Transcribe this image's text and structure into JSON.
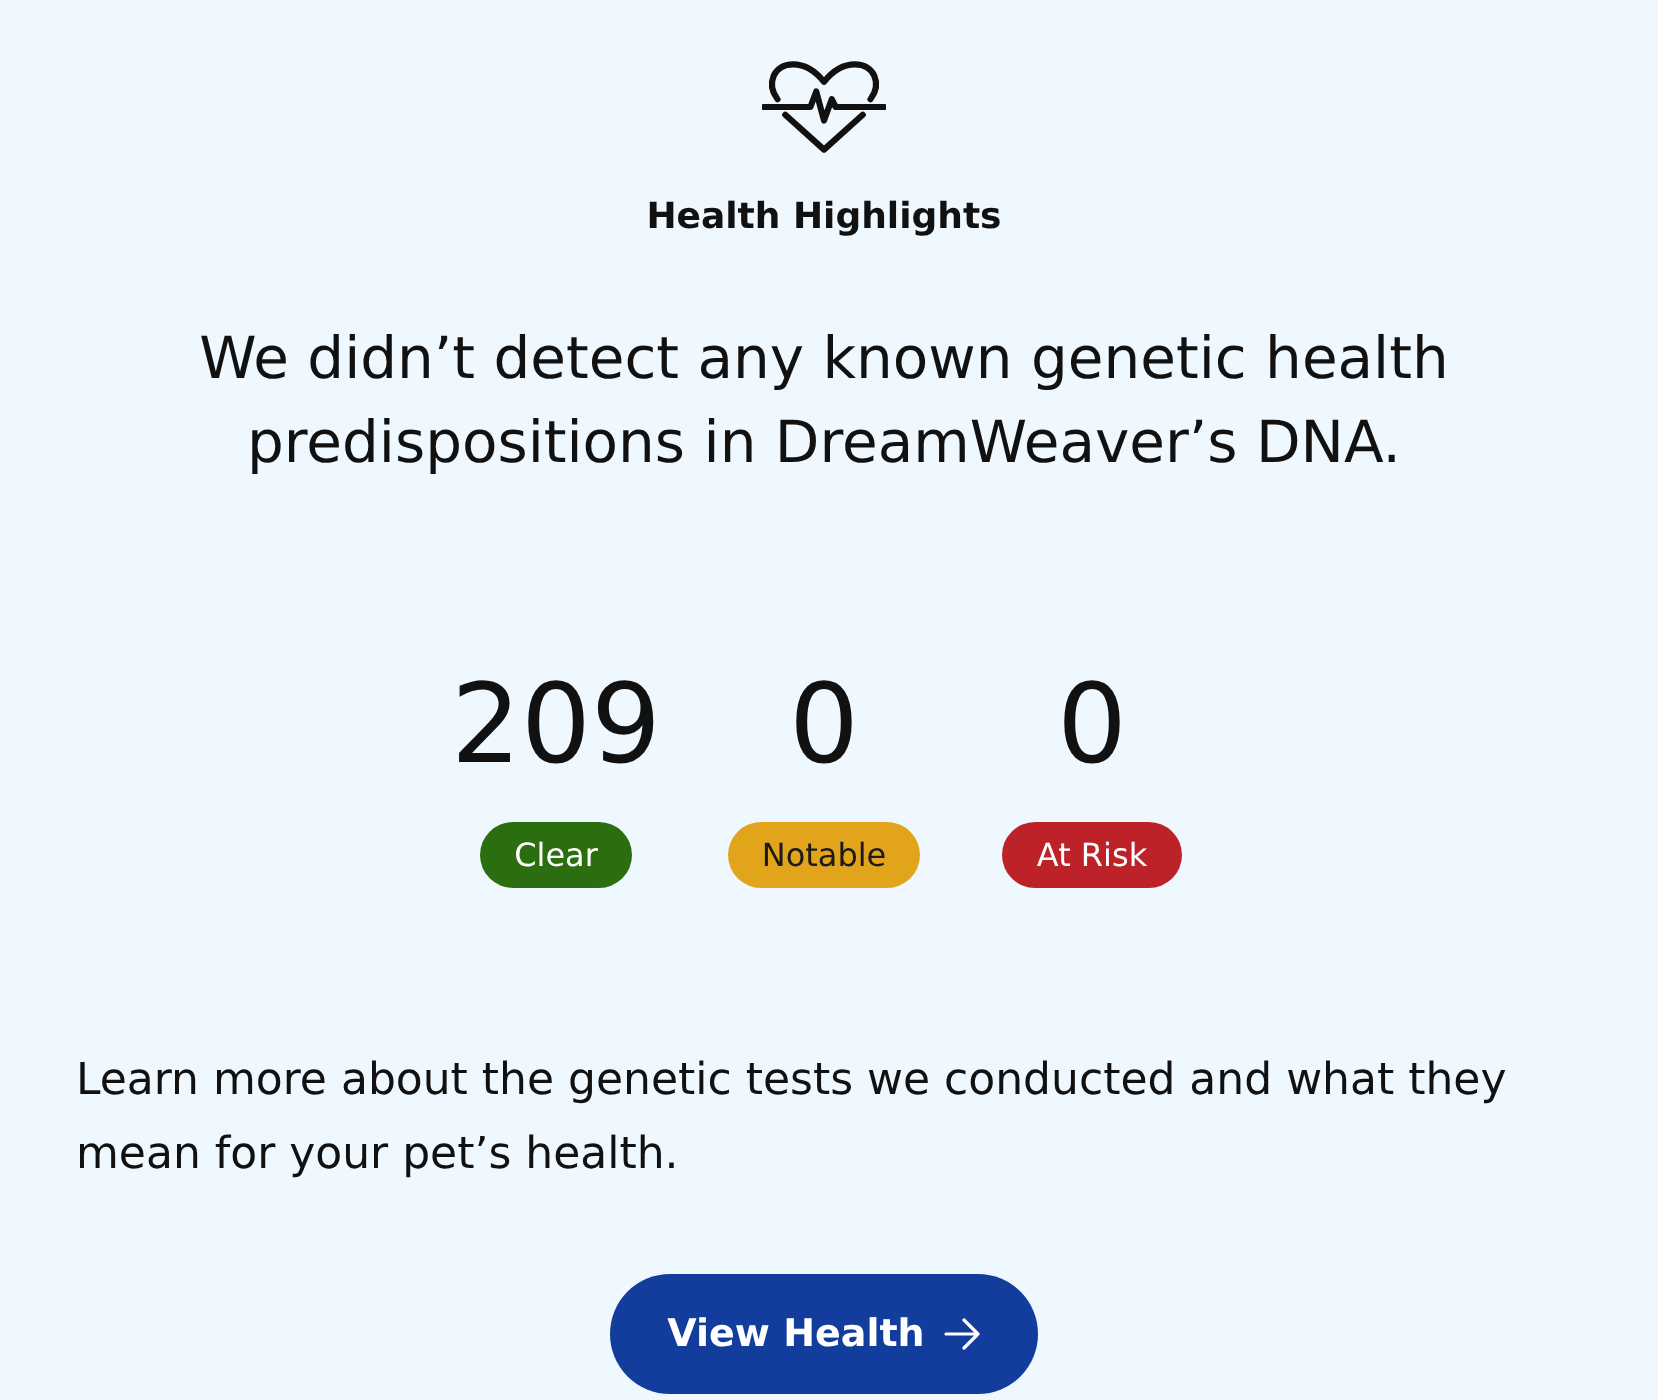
{
  "header": {
    "title": "Health Highlights"
  },
  "summary": "We didn’t detect any known genetic health predispositions in DreamWeaver’s DNA.",
  "results": [
    {
      "count": "209",
      "label": "Clear",
      "color": "#2a6e0f"
    },
    {
      "count": "0",
      "label": "Notable",
      "color": "#e2a41a"
    },
    {
      "count": "0",
      "label": "At Risk",
      "color": "#bc2228"
    }
  ],
  "learn_more": "Learn more about the genetic tests we conducted and what they mean for your pet’s health.",
  "button": {
    "label": "View Health"
  }
}
